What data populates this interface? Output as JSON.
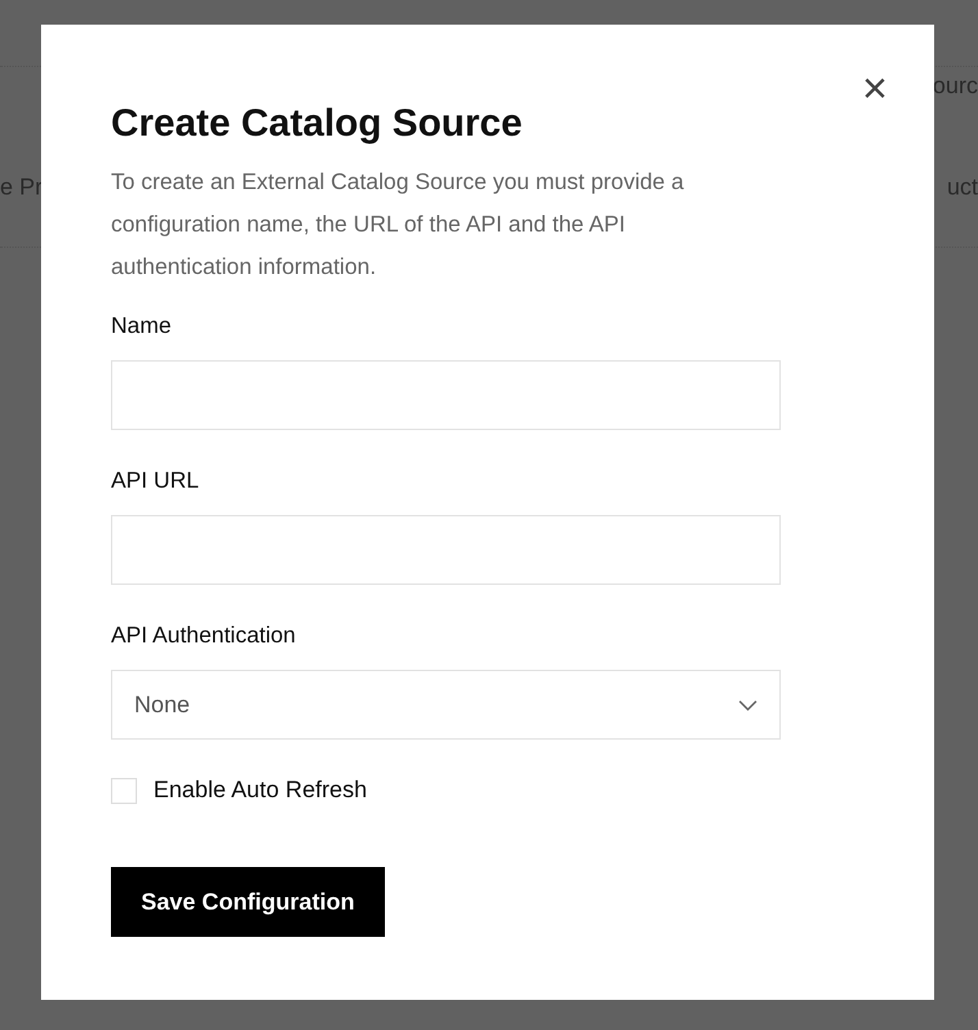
{
  "background": {
    "left_texts": [
      "e Pr"
    ],
    "right_texts": [
      "ourc",
      "uct"
    ]
  },
  "dialog": {
    "title": "Create Catalog Source",
    "close_icon": "×",
    "description": "To create an External Catalog Source you must provide a configuration name, the URL of the API and the API authentication information.",
    "fields": [
      {
        "kind": "text",
        "label": "Name"
      },
      {
        "kind": "text",
        "label": "API URL"
      },
      {
        "kind": "select",
        "label": "API Authentication",
        "value": "None"
      }
    ],
    "checkbox": {
      "label": "Enable Auto Refresh",
      "checked": false
    },
    "button": "Save Configuration"
  }
}
